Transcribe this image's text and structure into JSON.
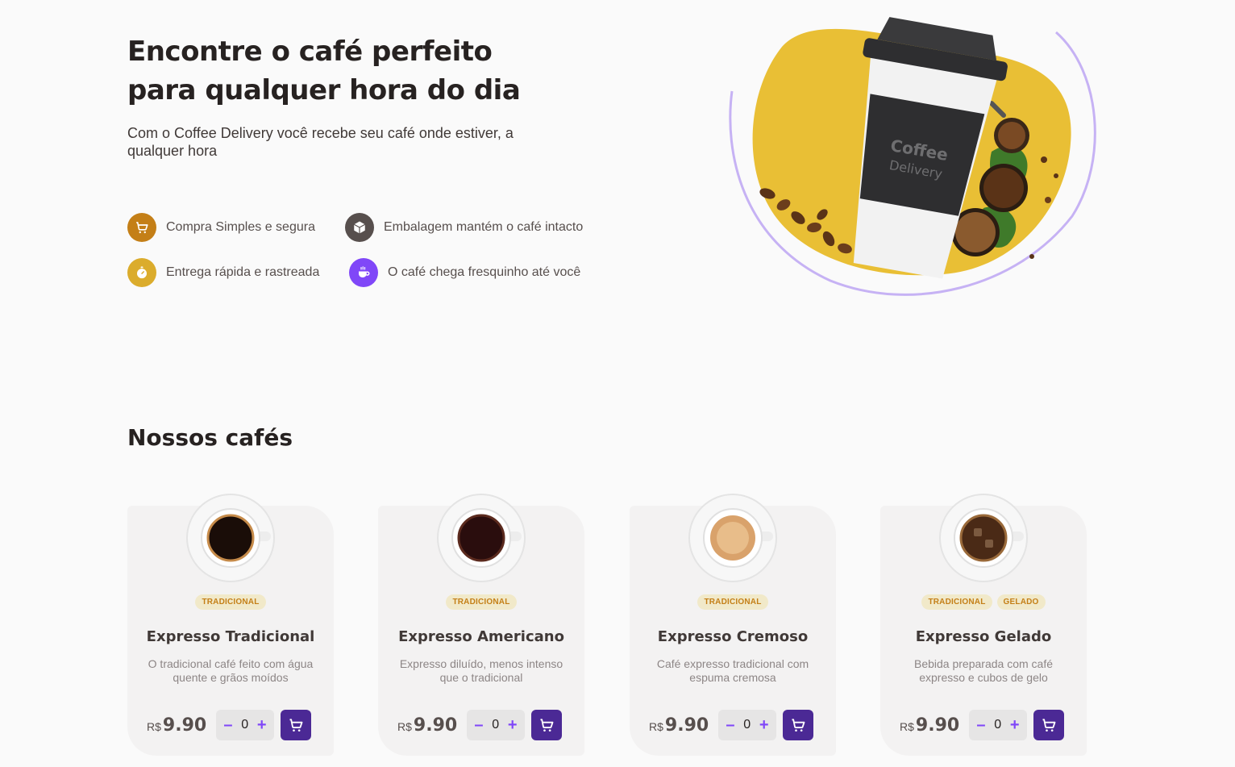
{
  "hero": {
    "title": "Encontre o café perfeito para qualquer hora do dia",
    "subtitle": "Com o Coffee Delivery você recebe seu café onde estiver, a qualquer hora",
    "features": [
      {
        "label": "Compra Simples e segura",
        "icon": "cart-icon",
        "color": "#c47f17"
      },
      {
        "label": "Embalagem mantém o café intacto",
        "icon": "package-icon",
        "color": "#574f4d"
      },
      {
        "label": "Entrega rápida e rastreada",
        "icon": "timer-icon",
        "color": "#dbac2c"
      },
      {
        "label": "O café chega fresquinho até você",
        "icon": "coffee-icon",
        "color": "#8047f8"
      }
    ],
    "cup_brand": [
      "Coffee",
      "Delivery"
    ]
  },
  "catalog": {
    "title": "Nossos cafés",
    "currency": "R$",
    "coffees": [
      {
        "name": "Expresso Tradicional",
        "description": "O tradicional café feito com água quente e grãos moídos",
        "tags": [
          "TRADICIONAL"
        ],
        "price": "9.90",
        "quantity": "0"
      },
      {
        "name": "Expresso Americano",
        "description": "Expresso diluído, menos intenso que o tradicional",
        "tags": [
          "TRADICIONAL"
        ],
        "price": "9.90",
        "quantity": "0"
      },
      {
        "name": "Expresso Cremoso",
        "description": "Café expresso tradicional com espuma cremosa",
        "tags": [
          "TRADICIONAL"
        ],
        "price": "9.90",
        "quantity": "0"
      },
      {
        "name": "Expresso Gelado",
        "description": "Bebida preparada com café expresso e cubos de gelo",
        "tags": [
          "TRADICIONAL",
          "GELADO"
        ],
        "price": "9.90",
        "quantity": "0"
      }
    ]
  },
  "colors": {
    "yellow_dark": "#c47f17",
    "yellow": "#dbac2c",
    "purple_dark": "#4b2995",
    "purple": "#8047f8",
    "base_text": "#574f4d"
  }
}
